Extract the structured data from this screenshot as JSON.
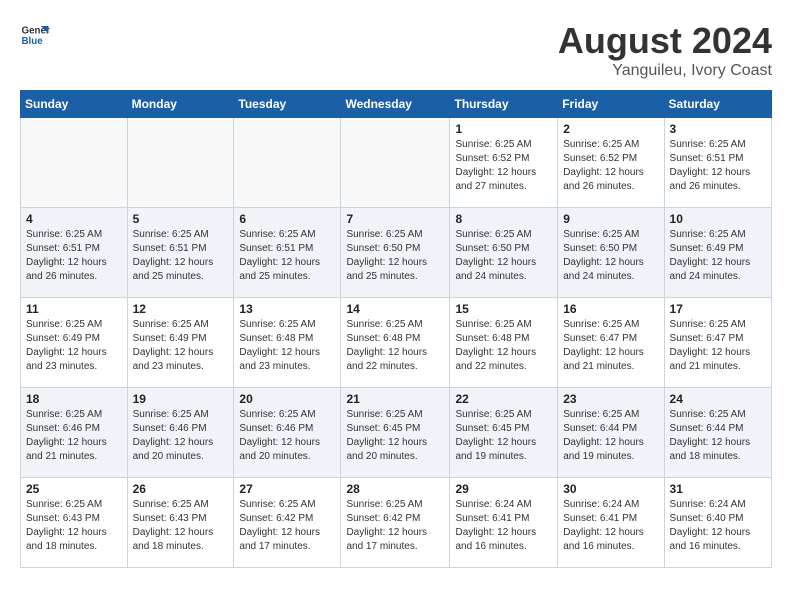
{
  "logo": {
    "line1": "General",
    "line2": "Blue"
  },
  "title": "August 2024",
  "subtitle": "Yanguileu, Ivory Coast",
  "headers": [
    "Sunday",
    "Monday",
    "Tuesday",
    "Wednesday",
    "Thursday",
    "Friday",
    "Saturday"
  ],
  "weeks": [
    [
      {
        "day": "",
        "info": ""
      },
      {
        "day": "",
        "info": ""
      },
      {
        "day": "",
        "info": ""
      },
      {
        "day": "",
        "info": ""
      },
      {
        "day": "1",
        "info": "Sunrise: 6:25 AM\nSunset: 6:52 PM\nDaylight: 12 hours\nand 27 minutes."
      },
      {
        "day": "2",
        "info": "Sunrise: 6:25 AM\nSunset: 6:52 PM\nDaylight: 12 hours\nand 26 minutes."
      },
      {
        "day": "3",
        "info": "Sunrise: 6:25 AM\nSunset: 6:51 PM\nDaylight: 12 hours\nand 26 minutes."
      }
    ],
    [
      {
        "day": "4",
        "info": "Sunrise: 6:25 AM\nSunset: 6:51 PM\nDaylight: 12 hours\nand 26 minutes."
      },
      {
        "day": "5",
        "info": "Sunrise: 6:25 AM\nSunset: 6:51 PM\nDaylight: 12 hours\nand 25 minutes."
      },
      {
        "day": "6",
        "info": "Sunrise: 6:25 AM\nSunset: 6:51 PM\nDaylight: 12 hours\nand 25 minutes."
      },
      {
        "day": "7",
        "info": "Sunrise: 6:25 AM\nSunset: 6:50 PM\nDaylight: 12 hours\nand 25 minutes."
      },
      {
        "day": "8",
        "info": "Sunrise: 6:25 AM\nSunset: 6:50 PM\nDaylight: 12 hours\nand 24 minutes."
      },
      {
        "day": "9",
        "info": "Sunrise: 6:25 AM\nSunset: 6:50 PM\nDaylight: 12 hours\nand 24 minutes."
      },
      {
        "day": "10",
        "info": "Sunrise: 6:25 AM\nSunset: 6:49 PM\nDaylight: 12 hours\nand 24 minutes."
      }
    ],
    [
      {
        "day": "11",
        "info": "Sunrise: 6:25 AM\nSunset: 6:49 PM\nDaylight: 12 hours\nand 23 minutes."
      },
      {
        "day": "12",
        "info": "Sunrise: 6:25 AM\nSunset: 6:49 PM\nDaylight: 12 hours\nand 23 minutes."
      },
      {
        "day": "13",
        "info": "Sunrise: 6:25 AM\nSunset: 6:48 PM\nDaylight: 12 hours\nand 23 minutes."
      },
      {
        "day": "14",
        "info": "Sunrise: 6:25 AM\nSunset: 6:48 PM\nDaylight: 12 hours\nand 22 minutes."
      },
      {
        "day": "15",
        "info": "Sunrise: 6:25 AM\nSunset: 6:48 PM\nDaylight: 12 hours\nand 22 minutes."
      },
      {
        "day": "16",
        "info": "Sunrise: 6:25 AM\nSunset: 6:47 PM\nDaylight: 12 hours\nand 21 minutes."
      },
      {
        "day": "17",
        "info": "Sunrise: 6:25 AM\nSunset: 6:47 PM\nDaylight: 12 hours\nand 21 minutes."
      }
    ],
    [
      {
        "day": "18",
        "info": "Sunrise: 6:25 AM\nSunset: 6:46 PM\nDaylight: 12 hours\nand 21 minutes."
      },
      {
        "day": "19",
        "info": "Sunrise: 6:25 AM\nSunset: 6:46 PM\nDaylight: 12 hours\nand 20 minutes."
      },
      {
        "day": "20",
        "info": "Sunrise: 6:25 AM\nSunset: 6:46 PM\nDaylight: 12 hours\nand 20 minutes."
      },
      {
        "day": "21",
        "info": "Sunrise: 6:25 AM\nSunset: 6:45 PM\nDaylight: 12 hours\nand 20 minutes."
      },
      {
        "day": "22",
        "info": "Sunrise: 6:25 AM\nSunset: 6:45 PM\nDaylight: 12 hours\nand 19 minutes."
      },
      {
        "day": "23",
        "info": "Sunrise: 6:25 AM\nSunset: 6:44 PM\nDaylight: 12 hours\nand 19 minutes."
      },
      {
        "day": "24",
        "info": "Sunrise: 6:25 AM\nSunset: 6:44 PM\nDaylight: 12 hours\nand 18 minutes."
      }
    ],
    [
      {
        "day": "25",
        "info": "Sunrise: 6:25 AM\nSunset: 6:43 PM\nDaylight: 12 hours\nand 18 minutes."
      },
      {
        "day": "26",
        "info": "Sunrise: 6:25 AM\nSunset: 6:43 PM\nDaylight: 12 hours\nand 18 minutes."
      },
      {
        "day": "27",
        "info": "Sunrise: 6:25 AM\nSunset: 6:42 PM\nDaylight: 12 hours\nand 17 minutes."
      },
      {
        "day": "28",
        "info": "Sunrise: 6:25 AM\nSunset: 6:42 PM\nDaylight: 12 hours\nand 17 minutes."
      },
      {
        "day": "29",
        "info": "Sunrise: 6:24 AM\nSunset: 6:41 PM\nDaylight: 12 hours\nand 16 minutes."
      },
      {
        "day": "30",
        "info": "Sunrise: 6:24 AM\nSunset: 6:41 PM\nDaylight: 12 hours\nand 16 minutes."
      },
      {
        "day": "31",
        "info": "Sunrise: 6:24 AM\nSunset: 6:40 PM\nDaylight: 12 hours\nand 16 minutes."
      }
    ]
  ]
}
